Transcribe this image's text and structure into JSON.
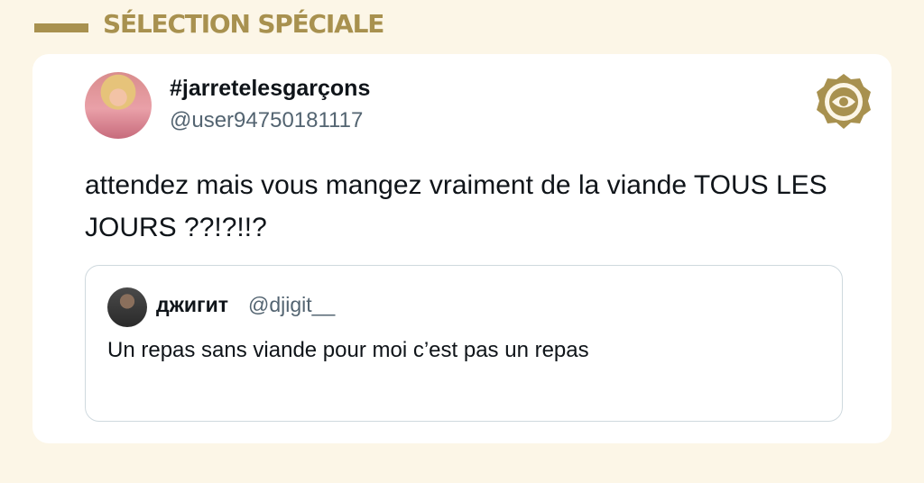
{
  "header": {
    "title": "SÉLECTION SPÉCIALE"
  },
  "tweet": {
    "display_name": "#jarretelesgarçons",
    "handle": "@user94750181117",
    "text": "attendez mais vous mangez vraiment de la viande TOUS LES JOURS ??!?!!?"
  },
  "quoted_tweet": {
    "display_name": "джигит",
    "handle": "@djigit__",
    "text": "Un repas sans viande pour moi c’est pas un repas"
  },
  "icons": {
    "logo": "brand-badge-icon"
  },
  "colors": {
    "accent": "#a8914f",
    "background": "#fcf6e7",
    "card": "#ffffff",
    "handle": "#536471"
  }
}
